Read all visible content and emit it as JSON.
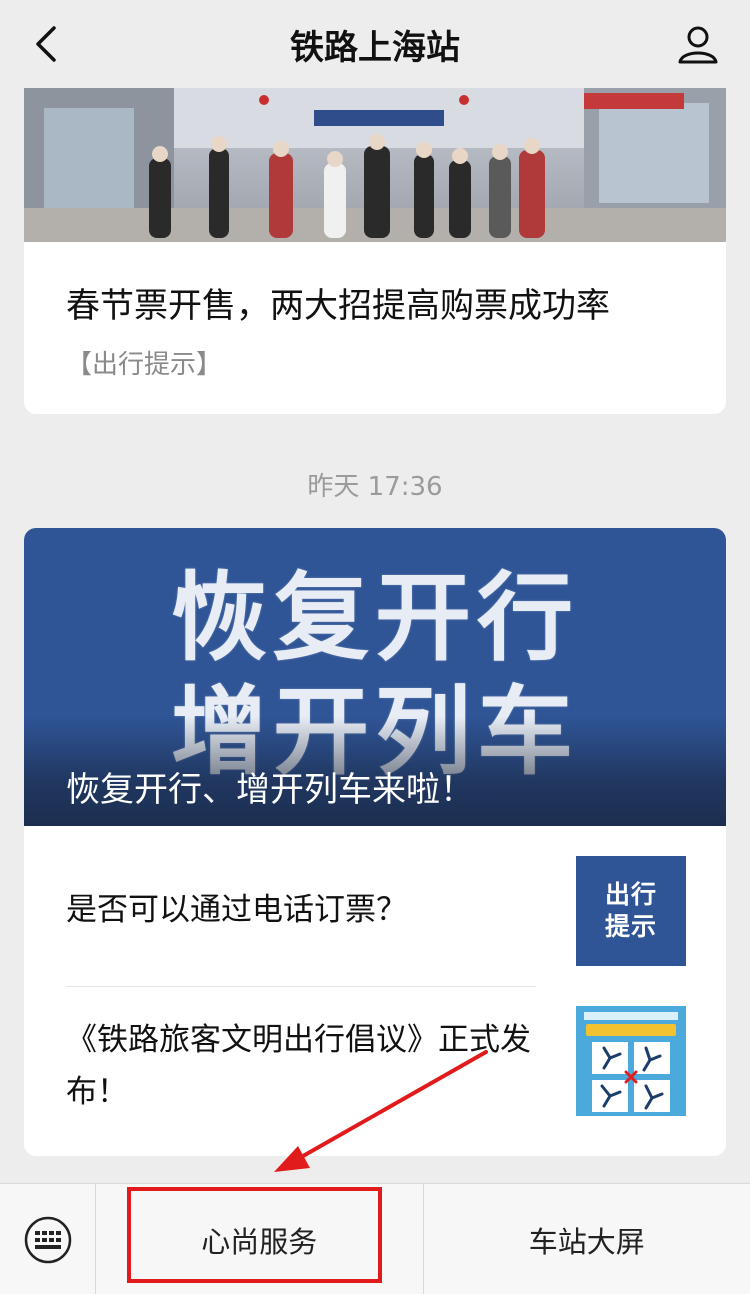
{
  "header": {
    "title": "铁路上海站"
  },
  "card1": {
    "title": "春节票开售，两大招提高购票成功率",
    "tag": "【出行提示】"
  },
  "timestamp": "昨天 17:36",
  "card2": {
    "hero_line1": "恢复开行",
    "hero_line2": "增开列车",
    "hero_caption": "恢复开行、增开列车来啦！",
    "articles": [
      {
        "title": "是否可以通过电话订票？",
        "thumb_line1": "出行",
        "thumb_line2": "提示"
      },
      {
        "title": "《铁路旅客文明出行倡议》正式发布！"
      }
    ]
  },
  "bottom_menu": {
    "items": [
      {
        "label": "心尚服务"
      },
      {
        "label": "车站大屏"
      }
    ]
  },
  "colors": {
    "background": "#ededed",
    "hero_blue": "#2f5597",
    "annotation_red": "#e11b1b"
  }
}
